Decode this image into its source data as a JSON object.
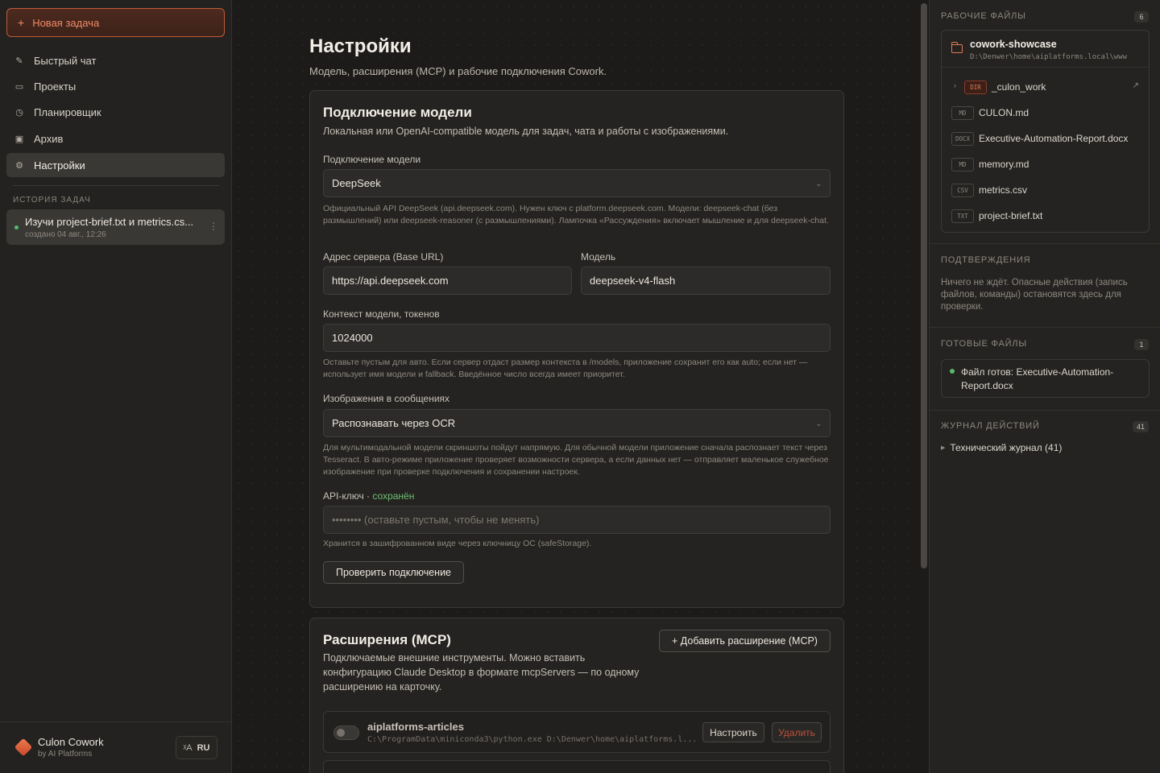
{
  "sidebar": {
    "new_task_label": "Новая задача",
    "nav": [
      {
        "label": "Быстрый чат",
        "icon": "pencil-icon"
      },
      {
        "label": "Проекты",
        "icon": "folder-icon"
      },
      {
        "label": "Планировщик",
        "icon": "clock-icon"
      },
      {
        "label": "Архив",
        "icon": "archive-icon"
      },
      {
        "label": "Настройки",
        "icon": "gear-icon",
        "active": true
      }
    ],
    "history_title": "ИСТОРИЯ ЗАДАЧ",
    "history": [
      {
        "title": "Изучи project-brief.txt и metrics.cs...",
        "subtitle": "создано 04 авг., 12:26"
      }
    ],
    "app_name": "Culon Cowork",
    "app_by": "by AI Platforms",
    "lang": "RU"
  },
  "main": {
    "title": "Настройки",
    "subtitle": "Модель, расширения (MCP) и рабочие подключения Cowork.",
    "model_card": {
      "title": "Подключение модели",
      "desc": "Локальная или OpenAI-compatible модель для задач, чата и работы с изображениями.",
      "provider_label": "Подключение модели",
      "provider_value": "DeepSeek",
      "provider_hint": "Официальный API DeepSeek (api.deepseek.com). Нужен ключ с platform.deepseek.com. Модели: deepseek-chat (без размышлений) или deepseek-reasoner (с размышлениями). Лампочка «Рассуждения» включает мышление и для deepseek-chat.",
      "base_url_label": "Адрес сервера (Base URL)",
      "base_url_value": "https://api.deepseek.com",
      "model_label": "Модель",
      "model_value": "deepseek-v4-flash",
      "context_label": "Контекст модели, токенов",
      "context_value": "1024000",
      "context_hint": "Оставьте пустым для авто. Если сервер отдаст размер контекста в /models, приложение сохранит его как auto; если нет — использует имя модели и fallback. Введённое число всегда имеет приоритет.",
      "images_label": "Изображения в сообщениях",
      "images_value": "Распознавать через OCR",
      "images_hint": "Для мультимодальной модели скриншоты пойдут напрямую. Для обычной модели приложение сначала распознает текст через Tesseract. В авто-режиме приложение проверяет возможности сервера, а если данных нет — отправляет маленькое служебное изображение при проверке подключения и сохранении настроек.",
      "api_key_label": "API-ключ · ",
      "api_key_status": "сохранён",
      "api_key_placeholder": "•••••••• (оставьте пустым, чтобы не менять)",
      "api_key_hint": "Хранится в зашифрованном виде через ключницу ОС (safeStorage).",
      "check_button": "Проверить подключение"
    },
    "mcp_card": {
      "title": "Расширения (MCP)",
      "desc": "Подключаемые внешние инструменты. Можно вставить конфигурацию Claude Desktop в формате mcpServers — по одному расширению на карточку.",
      "add_button": "+ Добавить расширение (MCP)",
      "items": [
        {
          "name": "aiplatforms-articles",
          "command": "C:\\ProgramData\\miniconda3\\python.exe D:\\Denwer\\home\\aiplatforms.l...",
          "enabled": false,
          "configure": "Настроить",
          "delete": "Удалить"
        }
      ]
    }
  },
  "right": {
    "work_files_title": "РАБОЧИЕ ФАЙЛЫ",
    "work_files_count": "6",
    "folder_name": "cowork-showcase",
    "folder_path": "D:\\Denwer\\home\\aiplatforms.local\\www",
    "files": [
      {
        "badge": "DIR",
        "name": "_culon_work",
        "is_dir": true
      },
      {
        "badge": "MD",
        "name": "CULON.md"
      },
      {
        "badge": "DOCX",
        "name": "Executive-Automation-Report.docx"
      },
      {
        "badge": "MD",
        "name": "memory.md"
      },
      {
        "badge": "CSV",
        "name": "metrics.csv"
      },
      {
        "badge": "TXT",
        "name": "project-brief.txt"
      }
    ],
    "confirm_title": "ПОДТВЕРЖДЕНИЯ",
    "confirm_text": "Ничего не ждёт. Опасные действия (запись файлов, команды) остановятся здесь для проверки.",
    "ready_title": "ГОТОВЫЕ ФАЙЛЫ",
    "ready_count": "1",
    "ready_item": "Файл готов: Executive-Automation-Report.docx",
    "journal_title": "ЖУРНАЛ ДЕЙСТВИЙ",
    "journal_count": "41",
    "journal_item": "Технический журнал (41)"
  },
  "colors": {
    "accent": "#e07a52",
    "background": "#1d1c1a",
    "success": "#58b96a",
    "danger": "#c0503c"
  }
}
